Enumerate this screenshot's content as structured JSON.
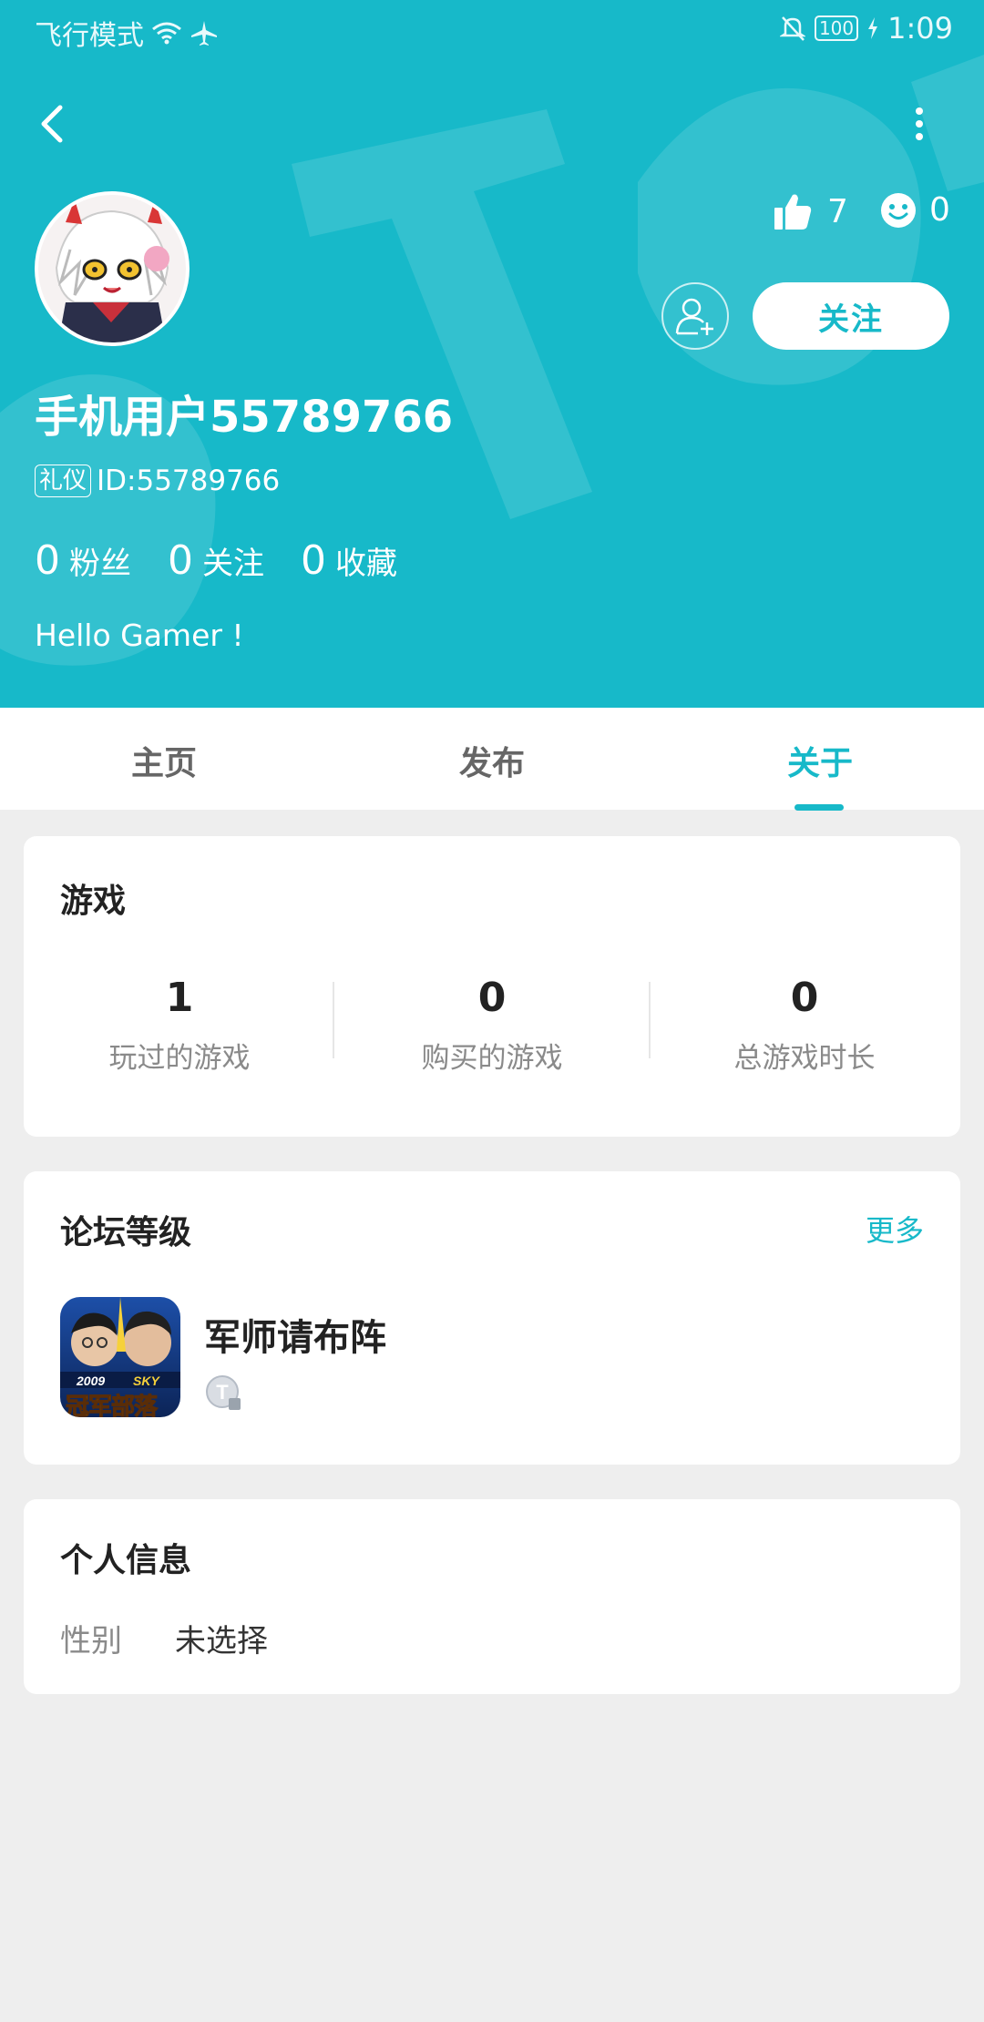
{
  "status_bar": {
    "left_text": "飞行模式",
    "battery": "100",
    "time": "1:09"
  },
  "header": {
    "likes": "7",
    "smiles": "0",
    "follow_label": "关注",
    "username": "手机用户55789766",
    "badge": "礼仪",
    "user_id": "ID:55789766",
    "counts": [
      {
        "num": "0",
        "label": "粉丝"
      },
      {
        "num": "0",
        "label": "关注"
      },
      {
        "num": "0",
        "label": "收藏"
      }
    ],
    "bio": "Hello Gamer !",
    "accent_color": "#17b9c9"
  },
  "tabs": [
    {
      "label": "主页"
    },
    {
      "label": "发布"
    },
    {
      "label": "关于",
      "active": true
    }
  ],
  "games_section": {
    "title": "游戏",
    "stats": [
      {
        "value": "1",
        "label": "玩过的游戏"
      },
      {
        "value": "0",
        "label": "购买的游戏"
      },
      {
        "value": "0",
        "label": "总游戏时长"
      }
    ]
  },
  "forum_section": {
    "title": "论坛等级",
    "more": "更多",
    "game_name": "军师请布阵",
    "icon_text_year": "2009",
    "icon_text_sky": "SKY",
    "icon_text_main": "冠军部落"
  },
  "info_section": {
    "title": "个人信息",
    "gender_label": "性别",
    "gender_value": "未选择"
  }
}
